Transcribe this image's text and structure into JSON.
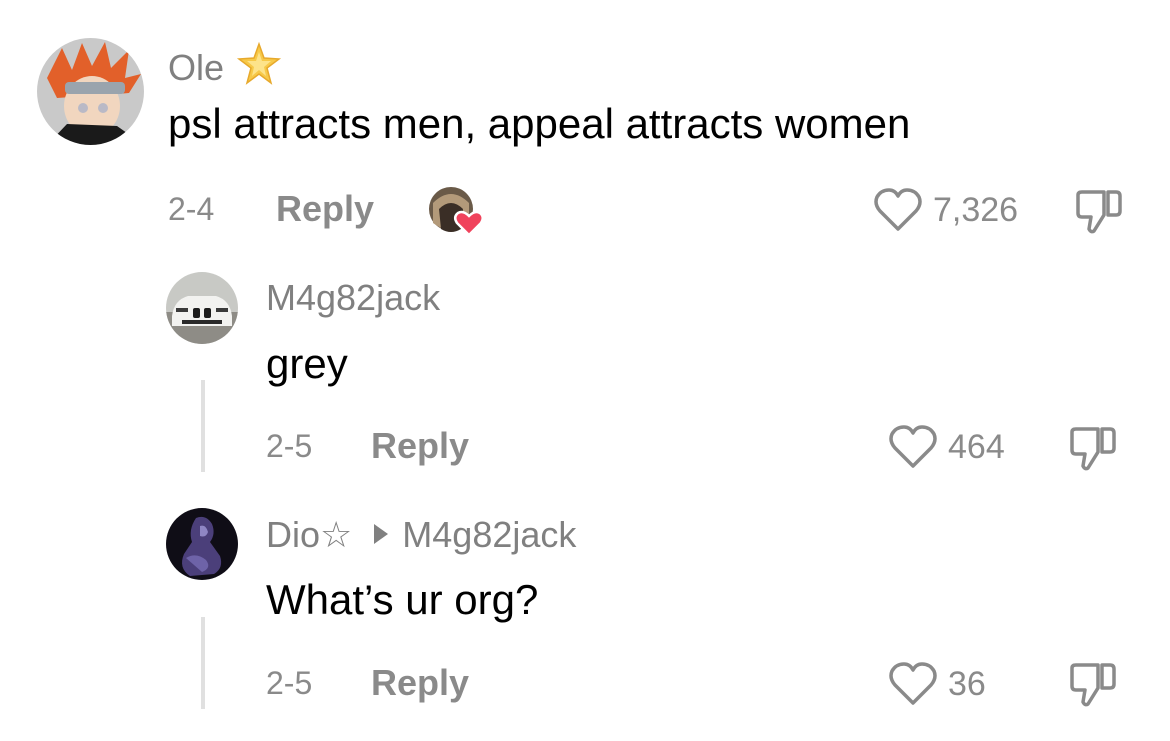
{
  "comments": [
    {
      "username": "Ole",
      "badge_icon": "sparkle-star-icon",
      "text": "psl attracts men, appeal attracts women",
      "date": "2-4",
      "reply_label": "Reply",
      "likes": "7,326",
      "creator_liked": true
    },
    {
      "username": "M4g82jack",
      "text": "grey",
      "date": "2-5",
      "reply_label": "Reply",
      "likes": "464"
    },
    {
      "username": "Dio☆",
      "reply_to": "M4g82jack",
      "text": "What’s ur org?",
      "date": "2-5",
      "reply_label": "Reply",
      "likes": "36"
    }
  ],
  "colors": {
    "meta_gray": "#8a8a8a",
    "heart_badge": "#f0435c",
    "star_gold": "#f7c948"
  }
}
